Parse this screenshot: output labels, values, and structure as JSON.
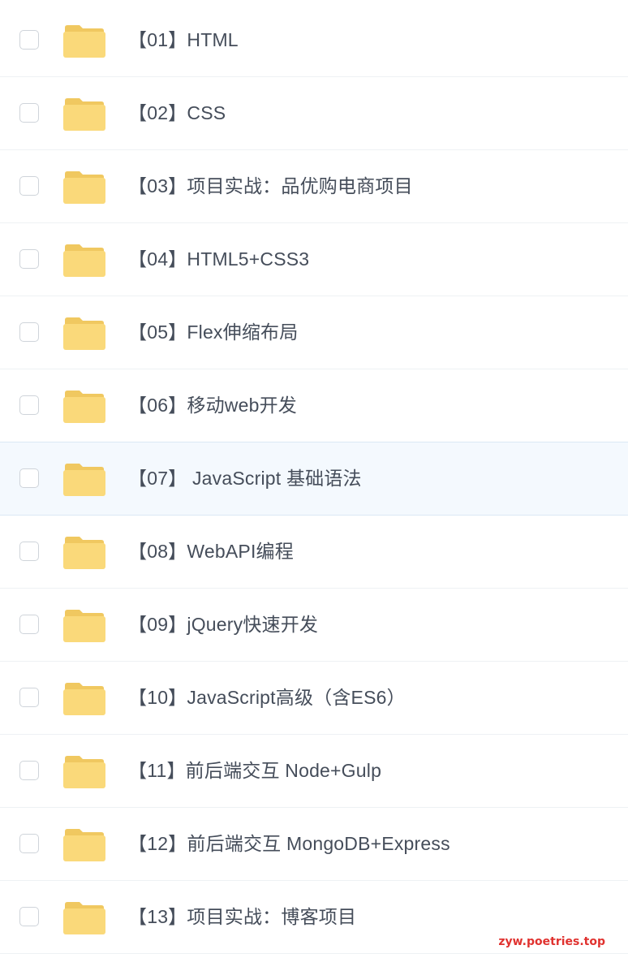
{
  "folders": [
    {
      "label": "【01】HTML"
    },
    {
      "label": "【02】CSS"
    },
    {
      "label": "【03】项目实战：品优购电商项目"
    },
    {
      "label": "【04】HTML5+CSS3"
    },
    {
      "label": "【05】Flex伸缩布局"
    },
    {
      "label": "【06】移动web开发"
    },
    {
      "label": "【07】 JavaScript 基础语法",
      "highlighted": true
    },
    {
      "label": "【08】WebAPI编程"
    },
    {
      "label": "【09】jQuery快速开发"
    },
    {
      "label": "【10】JavaScript高级（含ES6）"
    },
    {
      "label": "【11】前后端交互 Node+Gulp"
    },
    {
      "label": "【12】前后端交互 MongoDB+Express"
    },
    {
      "label": "【13】项目实战：博客项目"
    }
  ],
  "icons": {
    "checkbox": "checkbox-icon",
    "folder": "folder-icon"
  },
  "colors": {
    "folder_body": "#fad97a",
    "folder_tab": "#f0c860",
    "highlight_bg": "#f4f9fe",
    "text": "#454d5a",
    "watermark": "#e0322f"
  },
  "watermark": "zyw.poetries.top"
}
